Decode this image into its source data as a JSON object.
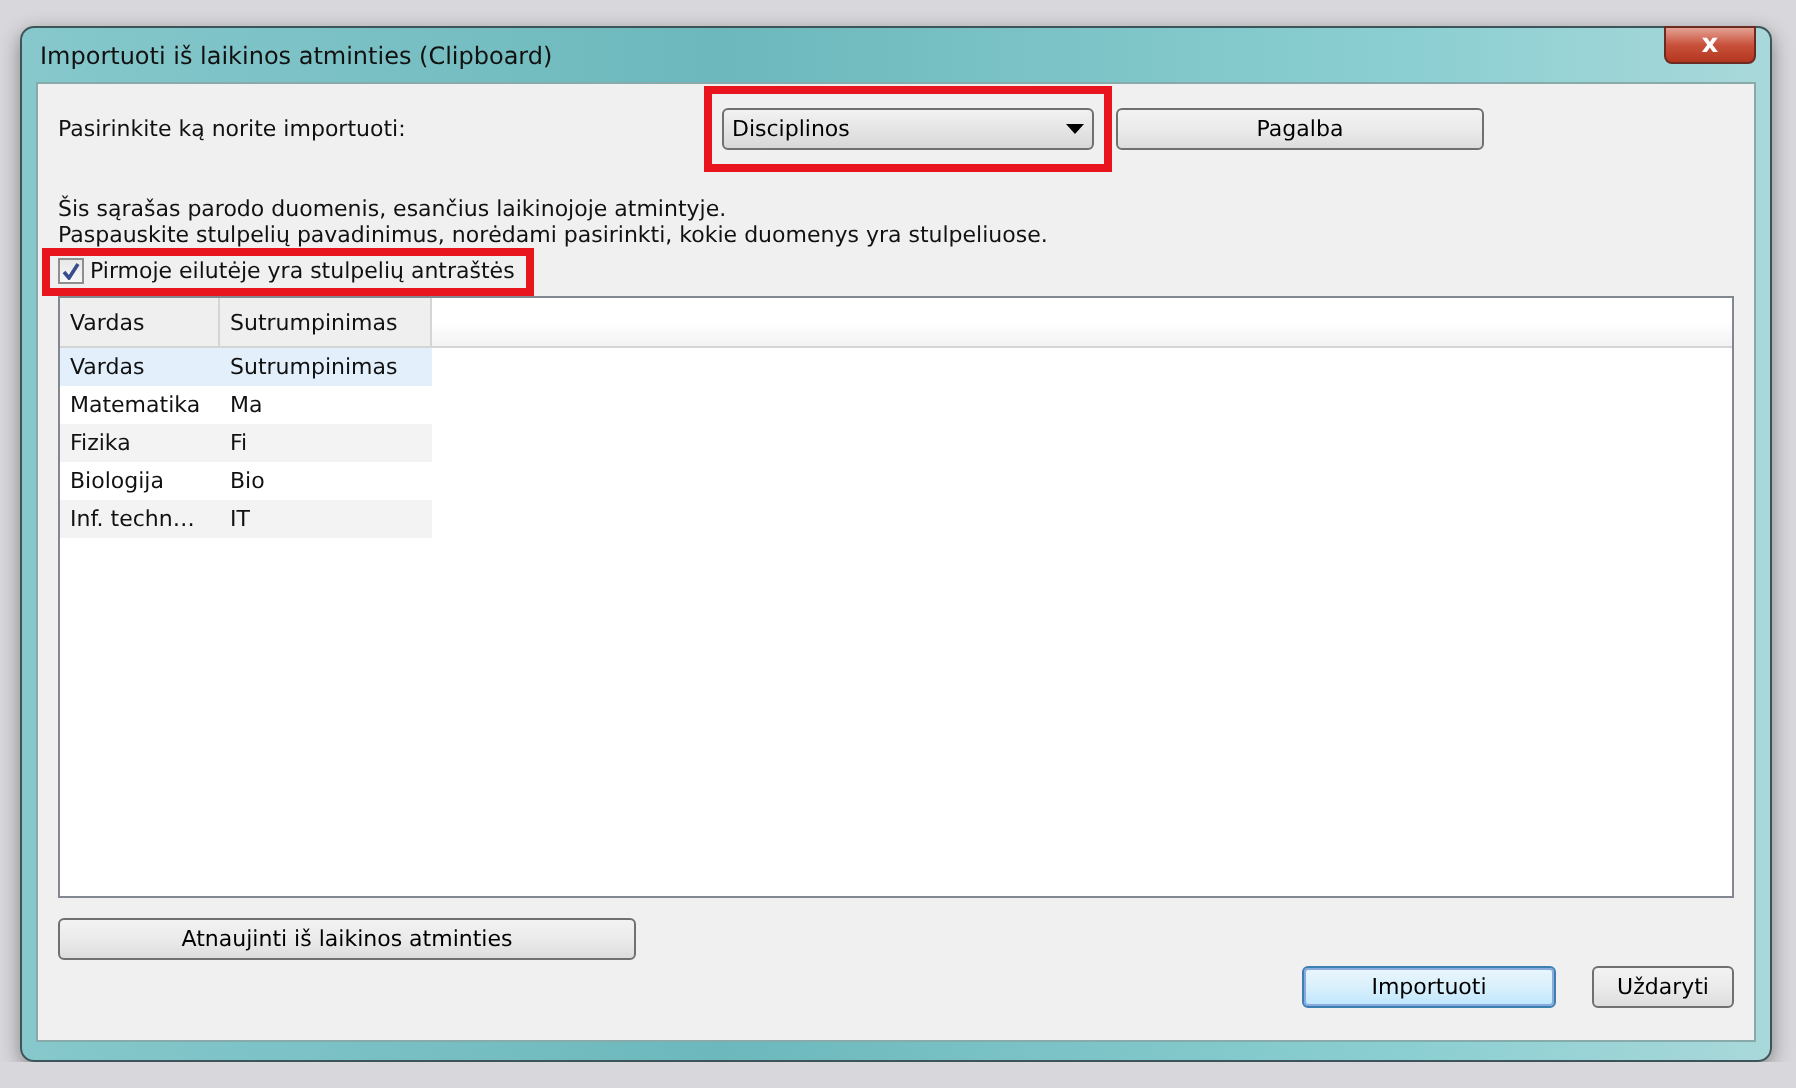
{
  "window": {
    "title": "Importuoti iš laikinos atminties (Clipboard)",
    "close_symbol": "x"
  },
  "import_label": "Pasirinkite ką norite importuoti:",
  "import_select": {
    "value": "Disciplinos",
    "highlighted": true
  },
  "help_button": "Pagalba",
  "info_lines": [
    "Šis sąrašas parodo duomenis, esančius laikinojoje atmintyje.",
    "Paspauskite stulpelių pavadinimus, norėdami pasirinkti, kokie duomenys yra stulpeliuose."
  ],
  "header_checkbox": {
    "label": "Pirmoje eilutėje yra stulpelių antraštės",
    "checked": true,
    "highlighted": true
  },
  "table": {
    "columns": [
      "Vardas",
      "Sutrumpinimas"
    ],
    "rows": [
      {
        "cells": [
          "Vardas",
          "Sutrumpinimas"
        ],
        "selected": true
      },
      {
        "cells": [
          "Matematika",
          "Ma"
        ],
        "selected": false
      },
      {
        "cells": [
          "Fizika",
          "Fi"
        ],
        "selected": false
      },
      {
        "cells": [
          "Biologija",
          "Bio"
        ],
        "selected": false
      },
      {
        "cells": [
          "Inf. techn…",
          "IT"
        ],
        "selected": false
      }
    ]
  },
  "refresh_button": "Atnaujinti iš laikinos atminties",
  "buttons": [
    {
      "label": "Importuoti",
      "kind": "default"
    },
    {
      "label": "Uždaryti",
      "kind": "normal"
    }
  ]
}
